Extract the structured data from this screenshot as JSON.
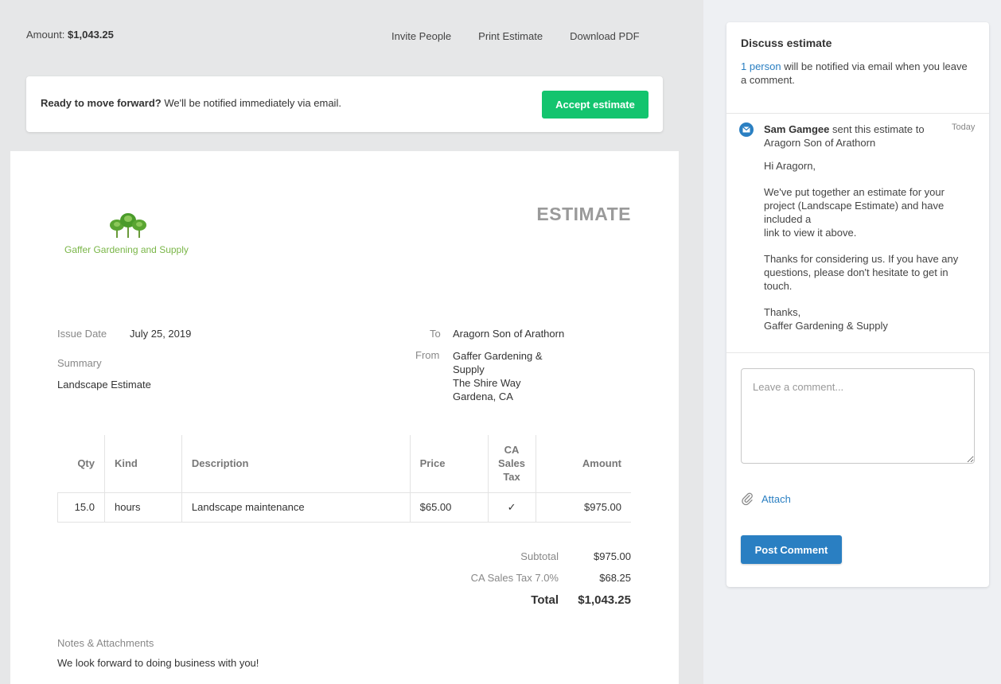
{
  "topbar": {
    "amount_label": "Amount:",
    "amount_value": "$1,043.25",
    "links": [
      "Invite People",
      "Print Estimate",
      "Download PDF"
    ]
  },
  "banner": {
    "bold": "Ready to move forward?",
    "text": "We'll be notified immediately via email.",
    "button": "Accept estimate"
  },
  "document": {
    "logo_text": "Gaffer Gardening and Supply",
    "title": "ESTIMATE",
    "issue_date_label": "Issue Date",
    "issue_date": "July 25, 2019",
    "summary_label": "Summary",
    "summary": "Landscape Estimate",
    "to_label": "To",
    "to": "Aragorn Son of Arathorn",
    "from_label": "From",
    "from_lines": [
      "Gaffer Gardening &",
      "Supply",
      "The Shire Way",
      "Gardena, CA"
    ],
    "table": {
      "headers": [
        "Qty",
        "Kind",
        "Description",
        "Price",
        "CA Sales Tax",
        "Amount"
      ],
      "rows": [
        {
          "qty": "15.0",
          "kind": "hours",
          "description": "Landscape maintenance",
          "price": "$65.00",
          "tax": "✓",
          "amount": "$975.00"
        }
      ]
    },
    "subtotal_label": "Subtotal",
    "subtotal": "$975.00",
    "tax_label": "CA Sales Tax 7.0%",
    "tax": "$68.25",
    "total_label": "Total",
    "total": "$1,043.25",
    "notes_label": "Notes & Attachments",
    "notes": "We look forward to doing business with you!"
  },
  "sidebar": {
    "title": "Discuss estimate",
    "notify_link": "1 person",
    "notify_text": " will be notified via email when you leave a comment.",
    "sender_name": "Sam Gamgee",
    "sender_action": " sent this estimate to Aragorn Son of Arathorn",
    "time": "Today",
    "message": [
      "Hi Aragorn,",
      "We've put together an estimate for your project (Landscape Estimate) and have included a\nlink to view it above.",
      "Thanks for considering us. If you have any questions, please don't hesitate to get in touch.",
      "Thanks,\nGaffer Gardening & Supply"
    ],
    "comment_placeholder": "Leave a comment...",
    "attach_label": "Attach",
    "post_button": "Post Comment"
  },
  "colors": {
    "accent_green": "#13c46e",
    "accent_blue": "#2a7fc2",
    "logo_green": "#7ab648"
  }
}
